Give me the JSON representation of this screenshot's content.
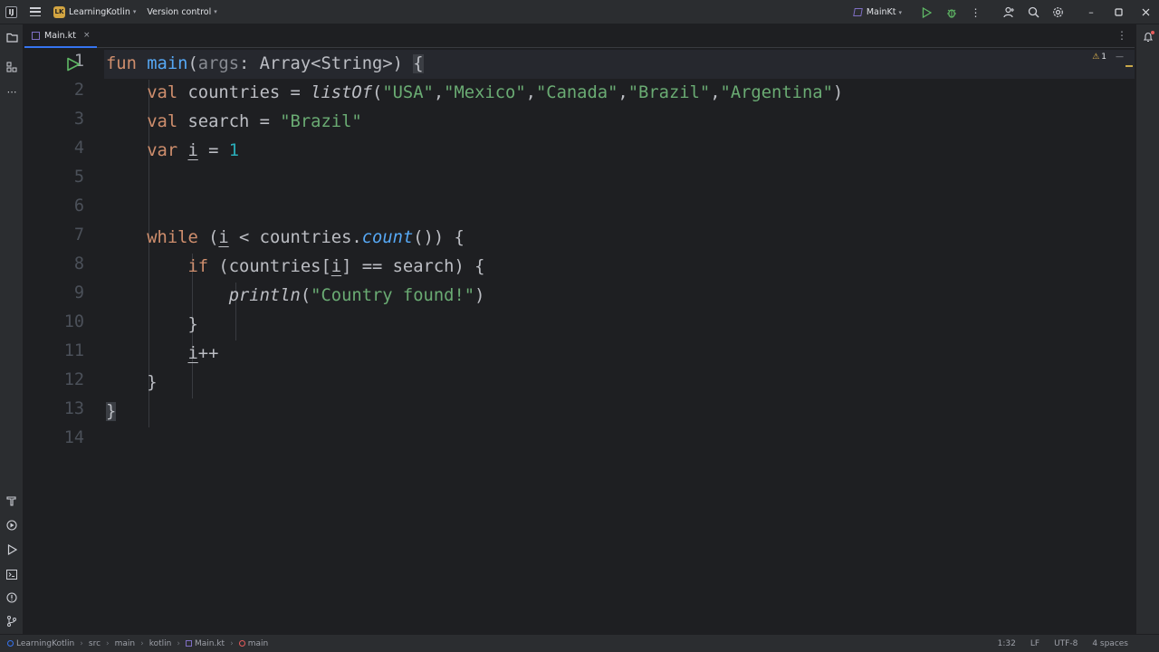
{
  "titlebar": {
    "app_icon_glyph": "IJ",
    "menu_icon": "hamburger-icon",
    "project_badge": "LK",
    "project_name": "LearningKotlin",
    "version_control": "Version control",
    "run_config": "MainKt"
  },
  "tab": {
    "label": "Main.kt",
    "close": "×"
  },
  "inspections": {
    "warnings": "1"
  },
  "code": {
    "line_numbers": [
      "1",
      "2",
      "3",
      "4",
      "5",
      "6",
      "7",
      "8",
      "9",
      "10",
      "11",
      "12",
      "13",
      "14"
    ],
    "line1": {
      "kw": "fun",
      "fn": "main",
      "open": "(",
      "param": "args",
      "rest": ": Array<String>) ",
      "brace": "{"
    },
    "line2": {
      "kw": "val",
      "name": " countries = ",
      "call": "listOf",
      "open": "(",
      "s1": "\"USA\"",
      "c1": ",",
      "s2": "\"Mexico\"",
      "c2": ",",
      "s3": "\"Canada\"",
      "c3": ",",
      "s4": "\"Brazil\"",
      "c4": ",",
      "s5": "\"Argentina\"",
      "close": ")"
    },
    "line3": {
      "kw": "val",
      "name": " search = ",
      "str": "\"Brazil\""
    },
    "line4": {
      "kw": "var",
      "sp": " ",
      "var": "i",
      "eq": " = ",
      "num": "1"
    },
    "line7": {
      "kw": "while",
      "open": " (",
      "var": "i",
      "mid": " < countries.",
      "call": "count",
      "close": "()) {"
    },
    "line8": {
      "kw": "if",
      "open": " (countries[",
      "var": "i",
      "close": "] == search) {"
    },
    "line9": {
      "call": "println",
      "open": "(",
      "str": "\"Country found!\"",
      "close": ")"
    },
    "line10": {
      "text": "}"
    },
    "line11": {
      "var": "i",
      "op": "++"
    },
    "line12": {
      "text": "}"
    },
    "line13": {
      "brace": "}"
    }
  },
  "statusbar": {
    "crumbs": [
      "LearningKotlin",
      "src",
      "main",
      "kotlin",
      "Main.kt",
      "main"
    ],
    "position": "1:32",
    "line_sep": "LF",
    "encoding": "UTF-8",
    "indent": "4 spaces"
  }
}
